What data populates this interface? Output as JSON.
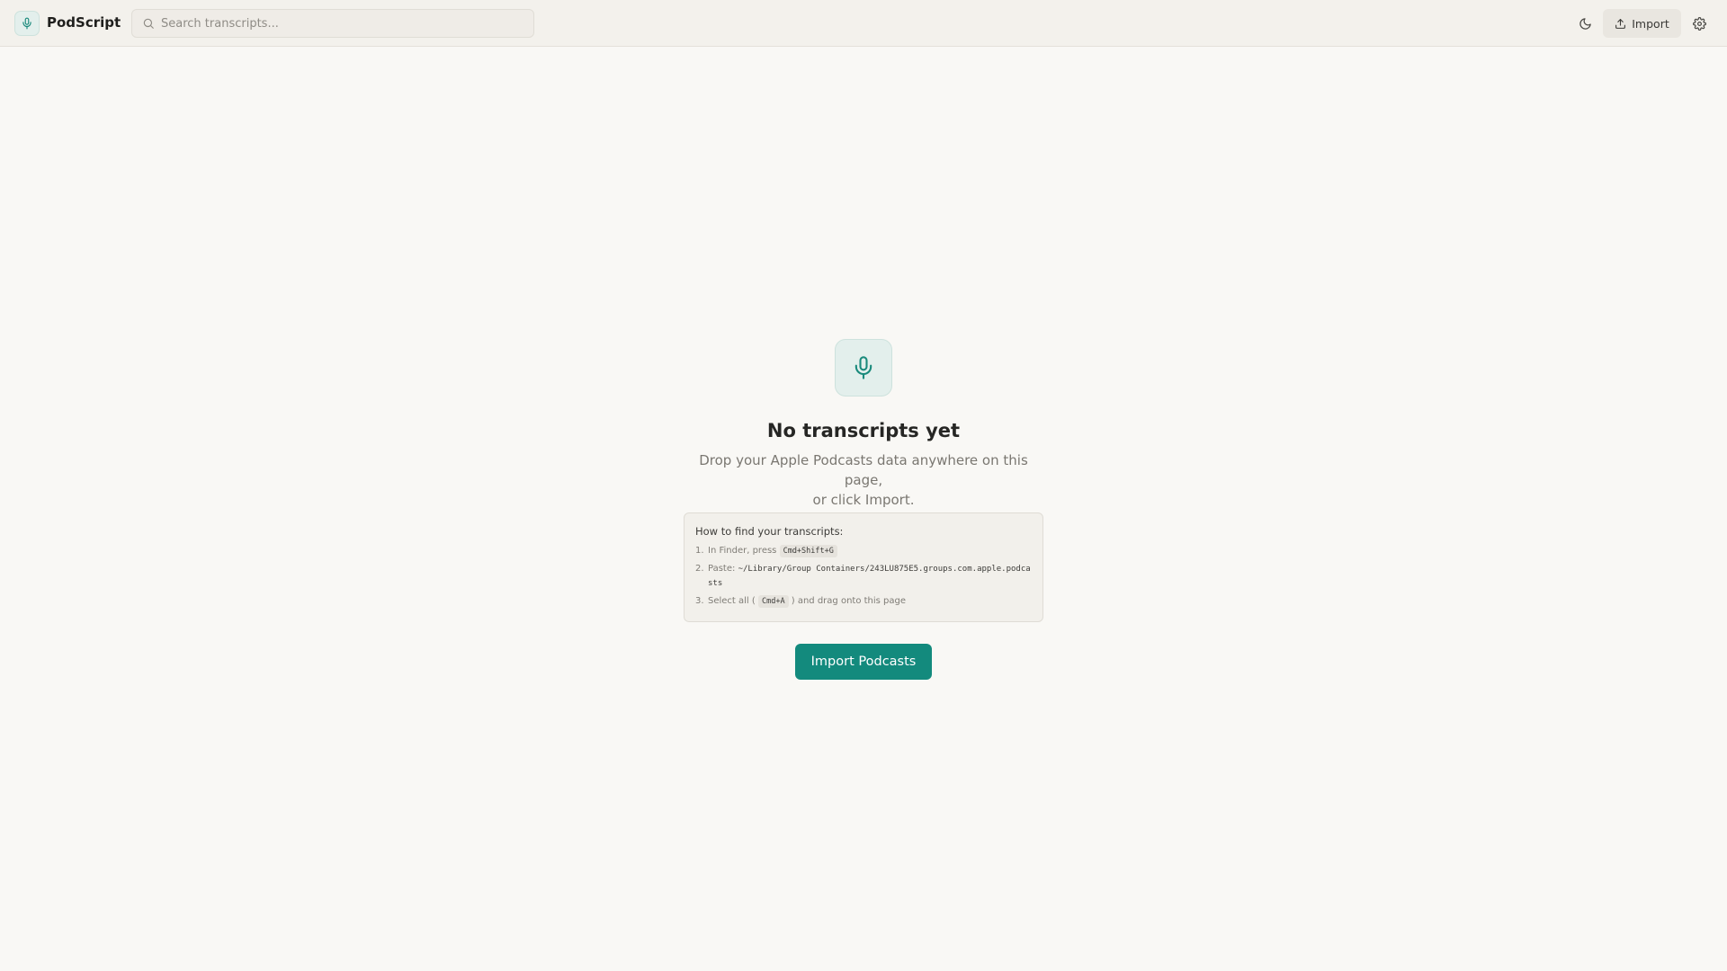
{
  "header": {
    "app_title": "PodScript",
    "logo_icon": "microphone-icon",
    "search": {
      "placeholder": "Search transcripts...",
      "value": ""
    },
    "theme_toggle_icon": "moon-icon",
    "import_label": "Import",
    "import_icon": "upload-icon",
    "settings_icon": "gear-icon"
  },
  "empty_state": {
    "icon": "microphone-icon",
    "title": "No transcripts yet",
    "description_line1": "Drop your Apple Podcasts data anywhere on this page,",
    "description_line2": "or click Import.",
    "help": {
      "title": "How to find your transcripts:",
      "steps": [
        {
          "num": "1.",
          "text_before": "In Finder, press",
          "kbd": "Cmd+Shift+G"
        },
        {
          "num": "2.",
          "text_before": "Paste:",
          "path": "~/Library/Group Containers/243LU875E5.groups.com.apple.podcasts"
        },
        {
          "num": "3.",
          "text_before": "Select all (",
          "kbd": "Cmd+A",
          "text_after": ") and drag onto this page"
        }
      ]
    },
    "button_label": "Import Podcasts"
  },
  "colors": {
    "accent": "#138a7d",
    "background": "#f9f8f5",
    "header_bg": "#f3f1ec",
    "icon_tint_bg": "#e3efec"
  }
}
